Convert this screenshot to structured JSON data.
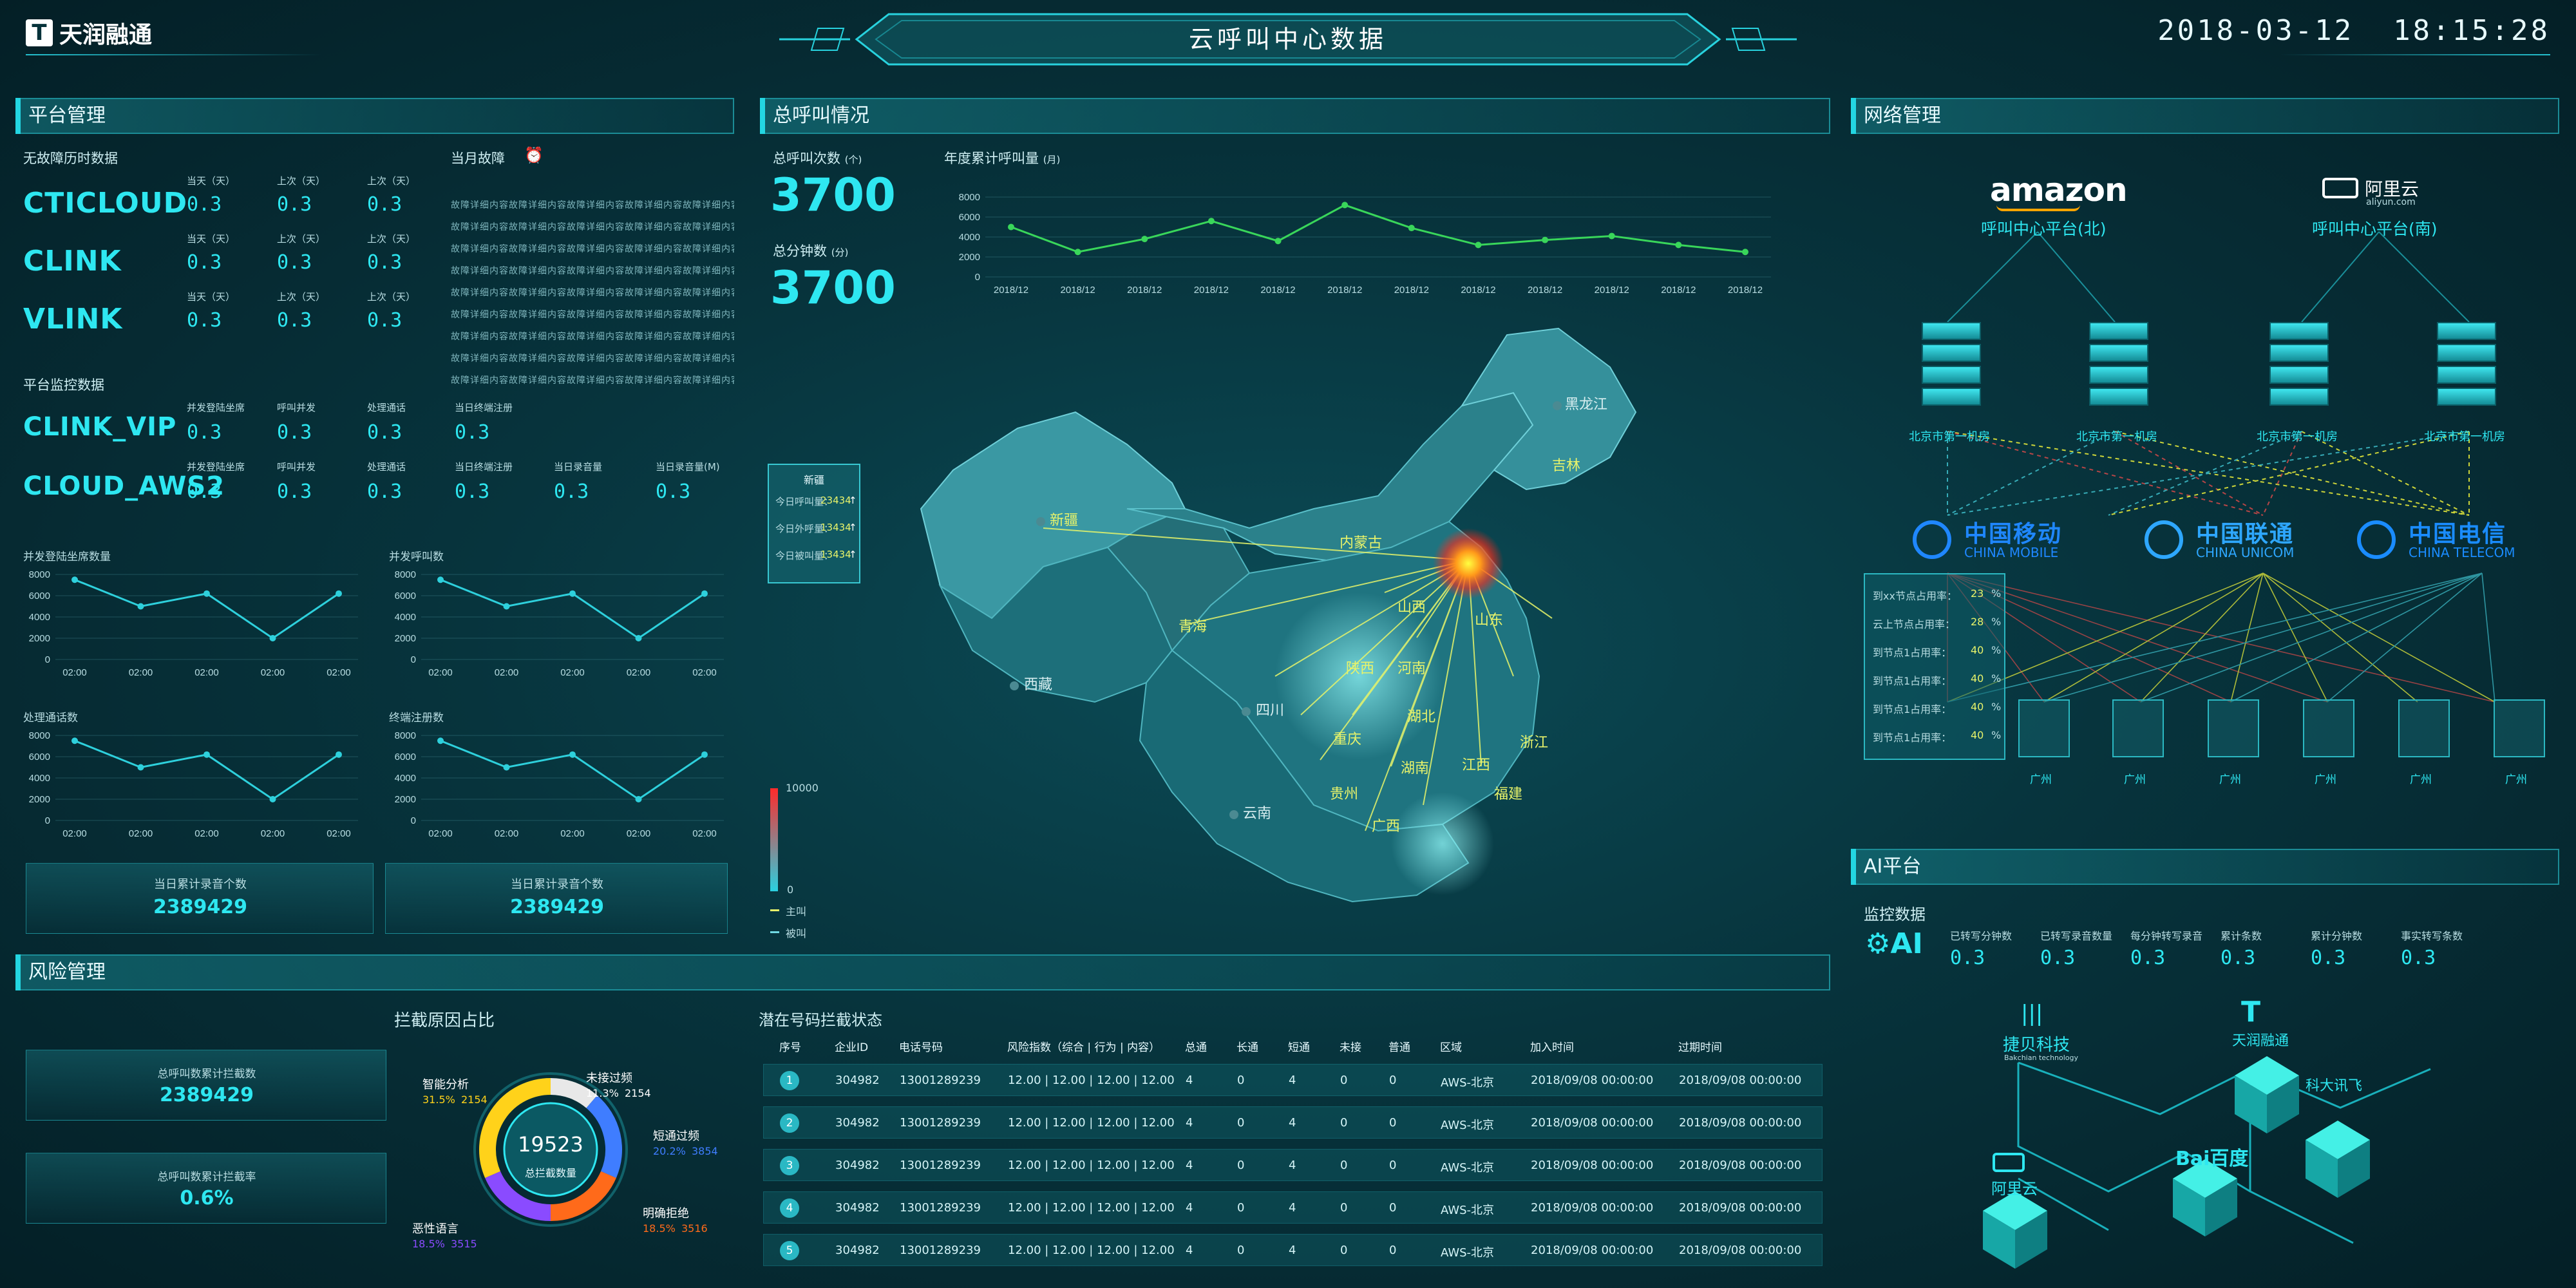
{
  "header": {
    "logo_text": "天润融通",
    "title": "云呼叫中心数据",
    "datetime": "2018-03-12  18:15:28"
  },
  "platform": {
    "section_title": "平台管理",
    "no_fault_title": "无故障历时数据",
    "month_fault_title": "当月故障",
    "col_labels": [
      "当天（天）",
      "上次（天）",
      "上次（天）"
    ],
    "systems": [
      {
        "name": "CTICLOUD",
        "values": [
          "0.3",
          "0.3",
          "0.3"
        ]
      },
      {
        "name": "CLINK",
        "values": [
          "0.3",
          "0.3",
          "0.3"
        ]
      },
      {
        "name": "VLINK",
        "values": [
          "0.3",
          "0.3",
          "0.3"
        ]
      }
    ],
    "fault_lines": [
      "故障详细内容故障详细内容故障详细内容故障详细内容故障详细内容故障",
      "故障详细内容故障详细内容故障详细内容故障详细内容故障详细内容故障",
      "故障详细内容故障详细内容故障详细内容故障详细内容故障详细内容故障",
      "故障详细内容故障详细内容故障详细内容故障详细内容故障详细内容故障",
      "故障详细内容故障详细内容故障详细内容故障详细内容故障详细内容故障",
      "故障详细内容故障详细内容故障详细内容故障详细内容故障详细内容故障",
      "故障详细内容故障详细内容故障详细内容故障详细内容故障详细内容故障",
      "故障详细内容故障详细内容故障详细内容故障详细内容故障详细内容故障",
      "故障详细内容故障详细内容故障详细内容故障详细内容故障详细内容故障"
    ],
    "monitor_title": "平台监控数据",
    "monitor_rows": [
      {
        "name": "CLINK_VIP",
        "labels": [
          "并发登陆坐席",
          "呼叫并发",
          "处理通话",
          "当日终端注册"
        ],
        "values": [
          "0.3",
          "0.3",
          "0.3",
          "0.3"
        ]
      },
      {
        "name": "CLOUD_AWS2",
        "labels": [
          "并发登陆坐席",
          "呼叫并发",
          "处理通话",
          "当日终端注册",
          "当日录音量",
          "当日录音量(M)"
        ],
        "values": [
          "0.3",
          "0.3",
          "0.3",
          "0.3",
          "0.3",
          "0.3"
        ]
      }
    ],
    "totals": [
      {
        "label": "当日累计录音个数",
        "value": "2389429"
      },
      {
        "label": "当日累计录音个数",
        "value": "2389429"
      }
    ]
  },
  "call_overview": {
    "section_title": "总呼叫情况",
    "total_calls_label": "总呼叫次数",
    "total_calls_unit": "(个)",
    "total_calls_value": "3700",
    "total_minutes_label": "总分钟数",
    "total_minutes_unit": "(分)",
    "total_minutes_value": "3700",
    "year_chart_title": "年度累计呼叫量",
    "year_chart_unit": "(月)"
  },
  "map": {
    "tooltip_title": "新疆",
    "tooltip_rows": [
      {
        "label": "今日呼叫量：",
        "value": "23434",
        "arrow": "↑"
      },
      {
        "label": "今日外呼量：",
        "value": "13434",
        "arrow": "↑"
      },
      {
        "label": "今日被叫量：",
        "value": "13434",
        "arrow": "↑"
      }
    ],
    "legend_max": "10000",
    "legend_min": "0",
    "legend_main": "主叫",
    "legend_called": "被叫",
    "provinces": [
      "新疆",
      "西藏",
      "青海",
      "内蒙古",
      "黑龙江",
      "吉林",
      "山西",
      "山东",
      "陕西",
      "河南",
      "四川",
      "湖北",
      "重庆",
      "湖南",
      "江西",
      "浙江",
      "贵州",
      "福建",
      "云南",
      "广西"
    ]
  },
  "network": {
    "section_title": "网络管理",
    "clouds": [
      {
        "brand": "amazon",
        "name": "呼叫中心平台(北)"
      },
      {
        "brand": "阿里云",
        "name": "呼叫中心平台(南)",
        "sub": "aliyun.com"
      }
    ],
    "servers": [
      "北京市第一机房",
      "北京市第一机房",
      "北京市第一机房",
      "北京市第一机房"
    ],
    "carriers": [
      {
        "cn": "中国移动",
        "en": "CHINA MOBILE"
      },
      {
        "cn": "中国联通",
        "en": "CHINA UNICOM"
      },
      {
        "cn": "中国电信",
        "en": "CHINA TELECOM"
      }
    ],
    "usage_rows": [
      {
        "label": "到xx节点占用率：",
        "value": "23",
        "unit": "%"
      },
      {
        "label": "云上节点占用率：",
        "value": "28",
        "unit": "%"
      },
      {
        "label": "到节点1占用率：",
        "value": "40",
        "unit": "%"
      },
      {
        "label": "到节点1占用率：",
        "value": "40",
        "unit": "%"
      },
      {
        "label": "到节点1占用率：",
        "value": "40",
        "unit": "%"
      },
      {
        "label": "到节点1占用率：",
        "value": "40",
        "unit": "%"
      }
    ],
    "switches": [
      "广州",
      "广州",
      "广州",
      "广州",
      "广州",
      "广州"
    ]
  },
  "ai": {
    "section_title": "AI平台",
    "monitor_title": "监控数据",
    "metrics": [
      {
        "label": "已转写分钟数",
        "value": "0.3"
      },
      {
        "label": "已转写录音数量",
        "value": "0.3"
      },
      {
        "label": "每分钟转写录音",
        "value": "0.3"
      },
      {
        "label": "累计条数",
        "value": "0.3"
      },
      {
        "label": "累计分钟数",
        "value": "0.3"
      },
      {
        "label": "事实转写条数",
        "value": "0.3"
      }
    ],
    "partners": [
      "捷贝科技",
      "天润融通",
      "科大讯飞",
      "阿里云",
      "Bai百度"
    ],
    "partner_sub": "Bakchian technology"
  },
  "risk": {
    "section_title": "风险管理",
    "donut_title": "拦截原因占比",
    "donut_center_value": "19523",
    "donut_center_label": "总拦截数量",
    "totals": [
      {
        "label": "总呼叫数累计拦截数",
        "value": "2389429"
      },
      {
        "label": "总呼叫数累计拦截率",
        "value": "0.6%"
      }
    ],
    "segments": [
      {
        "name": "未接过频",
        "pct": "11.3%",
        "count": "2154",
        "color": "#e8e8e8",
        "frac": 0.113
      },
      {
        "name": "短通过频",
        "pct": "20.2%",
        "count": "3854",
        "color": "#3f7dff",
        "frac": 0.202
      },
      {
        "name": "明确拒绝",
        "pct": "18.5%",
        "count": "3516",
        "color": "#ff6a1a",
        "frac": 0.185
      },
      {
        "name": "恶性语言",
        "pct": "18.5%",
        "count": "3515",
        "color": "#8a4bff",
        "frac": 0.185
      },
      {
        "name": "智能分析",
        "pct": "31.5%",
        "count": "2154",
        "color": "#ffd21a",
        "frac": 0.315
      }
    ],
    "table_title": "潜在号码拦截状态",
    "table_headers": [
      "序号",
      "企业ID",
      "电话号码",
      "风险指数（综合 | 行为 | 内容）",
      "总通",
      "长通",
      "短通",
      "未接",
      "普通",
      "区域",
      "加入时间",
      "过期时间"
    ],
    "table_rows": [
      [
        "1",
        "304982",
        "13001289239",
        "12.00    | 12.00 | 12.00 | 12.00",
        "4",
        "0",
        "4",
        "0",
        "0",
        "AWS-北京",
        "2018/09/08  00:00:00",
        "2018/09/08  00:00:00"
      ],
      [
        "2",
        "304982",
        "13001289239",
        "12.00    | 12.00 | 12.00 | 12.00",
        "4",
        "0",
        "4",
        "0",
        "0",
        "AWS-北京",
        "2018/09/08  00:00:00",
        "2018/09/08  00:00:00"
      ],
      [
        "3",
        "304982",
        "13001289239",
        "12.00    | 12.00 | 12.00 | 12.00",
        "4",
        "0",
        "4",
        "0",
        "0",
        "AWS-北京",
        "2018/09/08  00:00:00",
        "2018/09/08  00:00:00"
      ],
      [
        "4",
        "304982",
        "13001289239",
        "12.00    | 12.00 | 12.00 | 12.00",
        "4",
        "0",
        "4",
        "0",
        "0",
        "AWS-北京",
        "2018/09/08  00:00:00",
        "2018/09/08  00:00:00"
      ],
      [
        "5",
        "304982",
        "13001289239",
        "12.00    | 12.00 | 12.00 | 12.00",
        "4",
        "0",
        "4",
        "0",
        "0",
        "AWS-北京",
        "2018/09/08  00:00:00",
        "2018/09/08  00:00:00"
      ]
    ]
  },
  "chart_data": [
    {
      "type": "line",
      "title": "年度累计呼叫量",
      "categories": [
        "2018/12",
        "2018/12",
        "2018/12",
        "2018/12",
        "2018/12",
        "2018/12",
        "2018/12",
        "2018/12",
        "2018/12",
        "2018/12",
        "2018/12",
        "2018/12"
      ],
      "values": [
        5000,
        2500,
        3800,
        5600,
        3600,
        7200,
        4900,
        3200,
        3700,
        4100,
        3200,
        2500
      ],
      "ylim": [
        0,
        8000
      ],
      "yticks": [
        "8000",
        "6000",
        "4000",
        "2000",
        "0"
      ],
      "color": "#39d65a"
    },
    {
      "type": "line",
      "title": "并发登陆坐席数量",
      "categories": [
        "02:00",
        "02:00",
        "02:00",
        "02:00",
        "02:00"
      ],
      "values": [
        7500,
        5000,
        6200,
        2000,
        6200
      ],
      "ylim": [
        0,
        8000
      ],
      "yticks": [
        "8000",
        "6000",
        "4000",
        "2000",
        "0"
      ]
    },
    {
      "type": "line",
      "title": "并发呼叫数",
      "categories": [
        "02:00",
        "02:00",
        "02:00",
        "02:00",
        "02:00"
      ],
      "values": [
        7500,
        5000,
        6200,
        2000,
        6200
      ],
      "ylim": [
        0,
        8000
      ],
      "yticks": [
        "8000",
        "6000",
        "4000",
        "2000",
        "0"
      ]
    },
    {
      "type": "line",
      "title": "处理通话数",
      "categories": [
        "02:00",
        "02:00",
        "02:00",
        "02:00",
        "02:00"
      ],
      "values": [
        7500,
        5000,
        6200,
        2000,
        6200
      ],
      "ylim": [
        0,
        8000
      ],
      "yticks": [
        "8000",
        "6000",
        "4000",
        "2000",
        "0"
      ]
    },
    {
      "type": "line",
      "title": "终端注册数",
      "categories": [
        "02:00",
        "02:00",
        "02:00",
        "02:00",
        "02:00"
      ],
      "values": [
        7500,
        5000,
        6200,
        2000,
        6200
      ],
      "ylim": [
        0,
        8000
      ],
      "yticks": [
        "8000",
        "6000",
        "4000",
        "2000",
        "0"
      ]
    }
  ]
}
